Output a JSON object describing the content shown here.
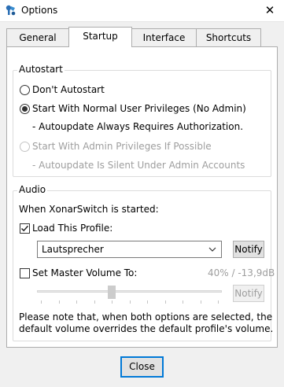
{
  "window": {
    "title": "Options",
    "close_glyph": "✕"
  },
  "tabs": [
    {
      "label": "General"
    },
    {
      "label": "Startup"
    },
    {
      "label": "Interface"
    },
    {
      "label": "Shortcuts"
    }
  ],
  "active_tab": "Startup",
  "autostart": {
    "group_label": "Autostart",
    "option_no_autostart": "Don't Autostart",
    "option_normal": "Start With Normal User Privileges (No Admin)",
    "note_normal": "- Autoupdate Always Requires Authorization.",
    "option_admin": "Start With Admin Privileges If Possible",
    "note_admin": "- Autoupdate Is Silent Under Admin Accounts",
    "selected": "normal"
  },
  "audio": {
    "group_label": "Audio",
    "intro": "When XonarSwitch is started:",
    "load_profile_label": "Load This Profile:",
    "load_profile_checked": true,
    "profile_value": "Lautsprecher",
    "notify_label": "Notify",
    "master_volume_label": "Set Master Volume To:",
    "master_volume_checked": false,
    "volume_readout": "40% / -13,9dB",
    "volume_level_percent": 40,
    "volume_notify_label": "Notify",
    "note_line1": "Please note that, when both options are selected, the",
    "note_line2": "default volume overrides the default profile's volume."
  },
  "footer": {
    "close_label": "Close"
  },
  "colors": {
    "accent": "#0078d7",
    "disabled_text": "#9e9e9e",
    "panel_bg": "#ffffff",
    "window_bg": "#f0f0f0"
  }
}
